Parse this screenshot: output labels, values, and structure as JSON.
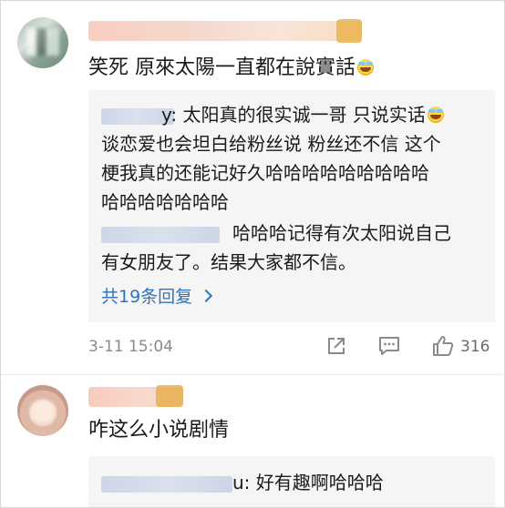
{
  "comment1": {
    "text": "笑死 原來太陽一直都在說實話",
    "emoji": "laughing-tears-emoji",
    "replies": [
      {
        "username_suffix": "y:",
        "lines": [
          "太阳真的很实诚一哥 只说实话",
          "谈恋爱也会坦白给粉丝说 粉丝还不信 这个",
          "梗我真的还能记好久哈哈哈哈哈哈哈哈哈",
          "哈哈哈哈哈哈哈"
        ]
      },
      {
        "username_suffix": "",
        "lines": [
          "哈哈哈记得有次太阳说自己",
          "有女朋友了。结果大家都不信。"
        ]
      }
    ],
    "more_replies_label": "共19条回复",
    "date": "3-11 15:04",
    "likes": "316"
  },
  "comment2": {
    "text": "咋这么小说剧情",
    "reply": {
      "username_suffix": "u:",
      "text": "好有趣啊哈哈哈"
    }
  },
  "colors": {
    "link": "#2f74c0",
    "meta": "#8a8a8a",
    "reply_bg": "#f5f5f5",
    "text": "#1a1a1a"
  }
}
